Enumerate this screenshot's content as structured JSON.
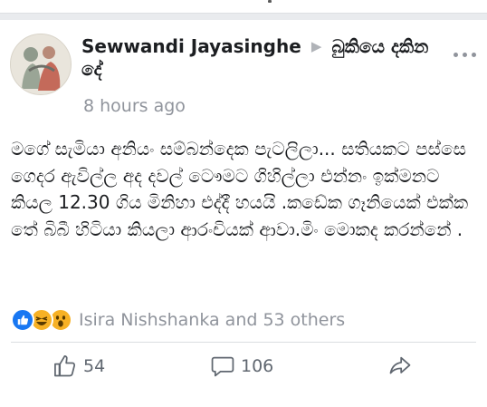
{
  "post": {
    "author": "Sewwandi Jayasinghe",
    "target": "බුකියෙ දකින දේ",
    "timestamp": "8 hours ago",
    "body": "මගේ සැමියා අනියං සම්බන්දෙක පැටලිලා... සතියකට පස්සෙ ගෙදර ඇවිල්ල අද දවල් ටෞමට ගිහිල්ලා එන්නං ඉක්මනට කියල 12.30 ගිය මිනිහා එද්දී හයයි .කඩේක ගෑනියෙක් එක්ක තේ බිබී හිටියා කියලා ආරංචියක් ආවා.මිං මොකද කරන්නේ ."
  },
  "reactions": {
    "types": [
      "like-icon",
      "haha-icon",
      "wow-icon"
    ],
    "summary": "Isira Nishshanka and 53 others"
  },
  "actions": {
    "likes": "54",
    "comments": "106"
  },
  "colors": {
    "like_blue": "#1877f2",
    "emoji_yellow": "#f7b125",
    "meta_gray": "#90949c"
  }
}
